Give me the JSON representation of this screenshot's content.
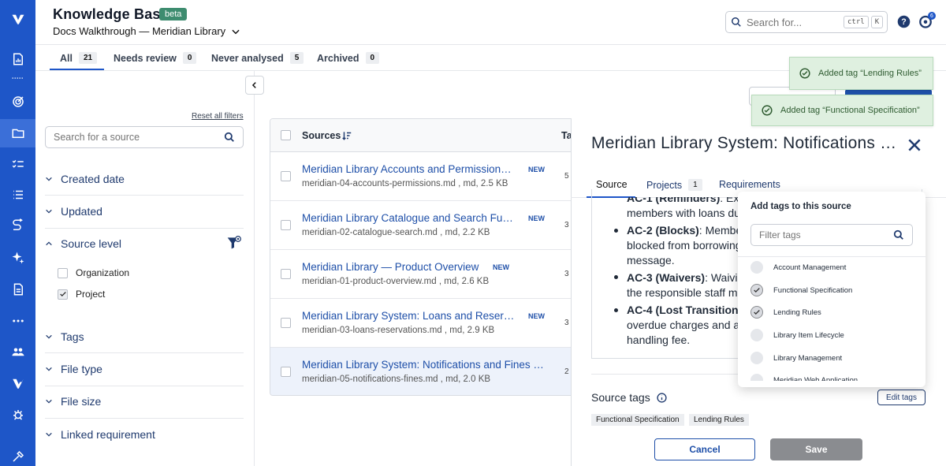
{
  "header": {
    "title": "Knowledge Base",
    "badge": "beta",
    "project": "Docs Walkthrough — Meridian Library",
    "search_placeholder": "Search for...",
    "shortcut_ctrl": "ctrl",
    "shortcut_key": "K",
    "notification_count": "6"
  },
  "tabs": [
    {
      "label": "All",
      "count": "21"
    },
    {
      "label": "Needs review",
      "count": "0"
    },
    {
      "label": "Never analysed",
      "count": "5"
    },
    {
      "label": "Archived",
      "count": "0"
    }
  ],
  "filters": {
    "reset_label": "Reset all filters",
    "search_placeholder": "Search for a source",
    "sections": [
      "Created date",
      "Updated",
      "Source level",
      "Tags",
      "File type",
      "File size",
      "Linked requirement"
    ],
    "source_level_options": [
      {
        "label": "Organization",
        "checked": false
      },
      {
        "label": "Project",
        "checked": true
      }
    ]
  },
  "table": {
    "header_sources": "Sources",
    "header_tags": "Ta",
    "rows": [
      {
        "name": "Meridian Library Accounts and Permission…",
        "new": "NEW",
        "meta": "meridian-04-accounts-permissions.md , md, 2.5 KB",
        "tags": "5"
      },
      {
        "name": "Meridian Library Catalogue and Search Fu…",
        "new": "NEW",
        "meta": "meridian-02-catalogue-search.md , md, 2.2 KB",
        "tags": "3"
      },
      {
        "name": "Meridian Library — Product Overview",
        "new": "NEW",
        "meta": "meridian-01-product-overview.md , md, 2.6 KB",
        "tags": "3"
      },
      {
        "name": "Meridian Library System: Loans and Reser…",
        "new": "NEW",
        "meta": "meridian-03-loans-reservations.md , md, 2.9 KB",
        "tags": "3"
      },
      {
        "name": "Meridian Library System: Notifications and Fines …",
        "new": "",
        "meta": "meridian-05-notifications-fines.md , md, 2.0 KB",
        "tags": "2"
      }
    ]
  },
  "drawer": {
    "title": "Meridian Library System: Notifications a…",
    "tabs": [
      {
        "label": "Source",
        "count": ""
      },
      {
        "label": "Projects",
        "count": "1"
      },
      {
        "label": "Requirements",
        "count": ""
      }
    ],
    "content": [
      {
        "key": "AC-1 (Reminders)",
        "text": ": Exac",
        "line2": "members with loans due"
      },
      {
        "key": "AC-2 (Blocks)",
        "text": ": Members",
        "line2": "blocked from borrowing/",
        "line3": "message."
      },
      {
        "key": "AC-3 (Waivers)",
        "text": ": Waiving",
        "line2": "the responsible staff mem"
      },
      {
        "key": "AC-4 (Lost Transition)",
        "text": ":",
        "line2": "overdue charges and app",
        "line3": "handling fee."
      }
    ],
    "source_tags_label": "Source tags",
    "edit_tags_label": "Edit tags",
    "tags": [
      "Functional Specification",
      "Lending Rules"
    ],
    "cancel_label": "Cancel",
    "save_label": "Save"
  },
  "tag_popup": {
    "title": "Add tags to this source",
    "filter_placeholder": "Filter tags",
    "options": [
      {
        "label": "Account Management",
        "checked": false
      },
      {
        "label": "Functional Specification",
        "checked": true
      },
      {
        "label": "Lending Rules",
        "checked": true
      },
      {
        "label": "Library Item Lifecycle",
        "checked": false
      },
      {
        "label": "Library Management",
        "checked": false
      },
      {
        "label": "Meridian Web Application",
        "checked": false
      }
    ]
  },
  "toasts": [
    "Added tag “Lending Rules”",
    "Added tag “Functional Specification”"
  ],
  "colors": {
    "brand": "#1e56c8",
    "link": "#1e4fa8",
    "toast_bg": "#dff0e0"
  }
}
